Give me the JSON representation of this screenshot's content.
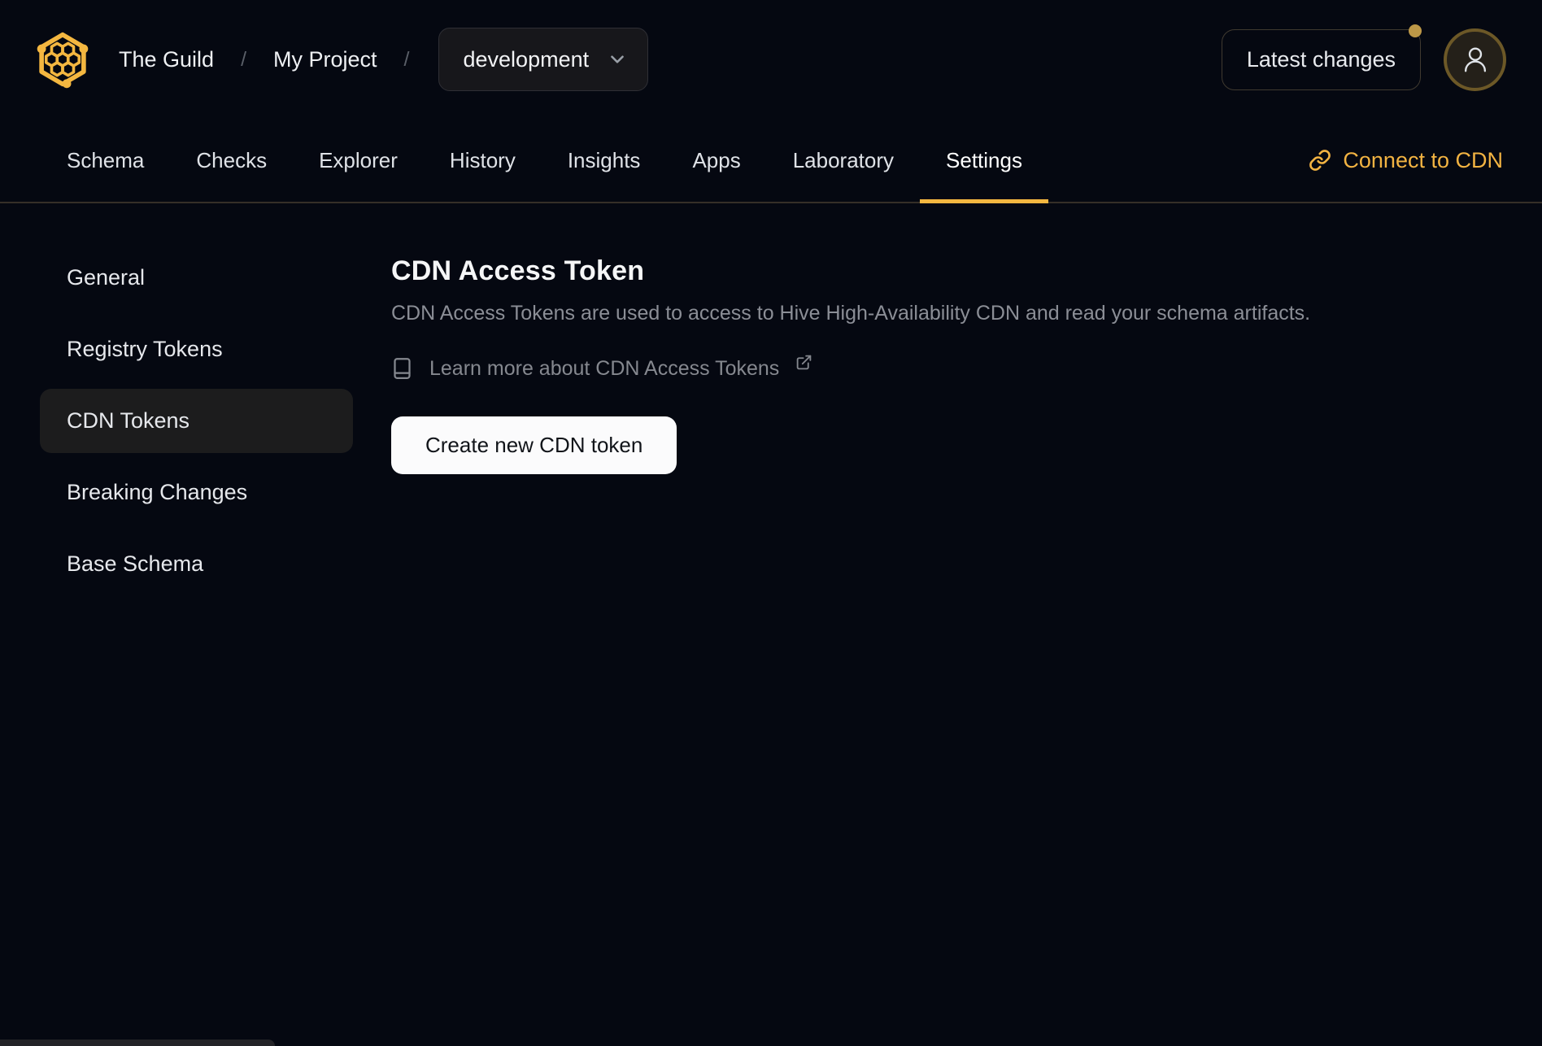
{
  "header": {
    "org": "The Guild",
    "separator": "/",
    "project": "My Project",
    "target_selector": {
      "value": "development"
    },
    "latest_changes_label": "Latest changes",
    "notification_dot": true
  },
  "nav": {
    "tabs": [
      {
        "label": "Schema",
        "active": false
      },
      {
        "label": "Checks",
        "active": false
      },
      {
        "label": "Explorer",
        "active": false
      },
      {
        "label": "History",
        "active": false
      },
      {
        "label": "Insights",
        "active": false
      },
      {
        "label": "Apps",
        "active": false
      },
      {
        "label": "Laboratory",
        "active": false
      },
      {
        "label": "Settings",
        "active": true
      }
    ],
    "connect_cdn_label": "Connect to CDN"
  },
  "sidebar": {
    "items": [
      {
        "label": "General",
        "active": false
      },
      {
        "label": "Registry Tokens",
        "active": false
      },
      {
        "label": "CDN Tokens",
        "active": true
      },
      {
        "label": "Breaking Changes",
        "active": false
      },
      {
        "label": "Base Schema",
        "active": false
      }
    ]
  },
  "main": {
    "title": "CDN Access Token",
    "description": "CDN Access Tokens are used to access to Hive High-Availability CDN and read your schema artifacts.",
    "learn_more_label": "Learn more about CDN Access Tokens",
    "create_button_label": "Create new CDN token"
  },
  "icons": {
    "logo": "hive-honeycomb-logo",
    "breadcrumb_dropdown": "chevron-down-icon",
    "connect_cdn": "link-chain-icon",
    "learn_more": "book-icon",
    "learn_more_external": "external-link-icon",
    "avatar": "user-icon"
  },
  "colors": {
    "background": "#050811",
    "accent_gold": "#f4b740",
    "notification_dot": "#bd9847",
    "avatar_ring": "#6c5827",
    "active_item_bg": "#1c1c1d",
    "muted_text": "#8b8e96",
    "nav_border": "#352f28",
    "button_bg": "#fbfbfc"
  }
}
